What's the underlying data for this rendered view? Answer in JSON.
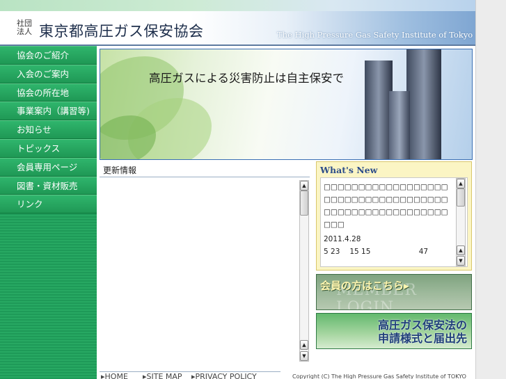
{
  "header": {
    "org_type": "社団法人",
    "org_name": "東京都高圧ガス保安協会",
    "org_name_en": "The High Pressure Gas Safety Institute of Tokyo"
  },
  "sidebar": {
    "items": [
      {
        "label": "協会のご紹介"
      },
      {
        "label": "入会のご案内"
      },
      {
        "label": "協会の所在地"
      },
      {
        "label": "事業案内（講習等)"
      },
      {
        "label": "お知らせ"
      },
      {
        "label": "トピックス"
      },
      {
        "label": "会員専用ページ"
      },
      {
        "label": "図書・資材販売"
      },
      {
        "label": "リンク"
      }
    ]
  },
  "hero": {
    "slogan": "高圧ガスによる災害防止は自主保安で"
  },
  "updates": {
    "title": "更新情報"
  },
  "whats_new": {
    "title": "What's New",
    "body": "□□□□□□□□□□□□□□□□□□□□□□□□□□□□□□□□□□□□□□□□□□□□□□□□□□□□□□□□□",
    "date": "2011.4.28",
    "row": [
      "5 23",
      "15 15",
      "47"
    ]
  },
  "buttons": {
    "member_label": "会員の方はこちら▸",
    "member_watermark": "MEMBER LOGIN",
    "law_line1": "高圧ガス保安法の",
    "law_line2": "申請様式と届出先"
  },
  "footer": {
    "links": [
      "▸HOME",
      "▸SITE MAP",
      "▸PRIVACY POLICY"
    ],
    "copyright": "Copyright (C) The High Pressure Gas Safety Institute of TOKYO"
  },
  "colors": {
    "sidebar_green": "#1e9a58",
    "hero_border": "#3a6fb4",
    "whats_new_bg": "#fbf5c4",
    "title_blue": "#2d4d8a"
  }
}
